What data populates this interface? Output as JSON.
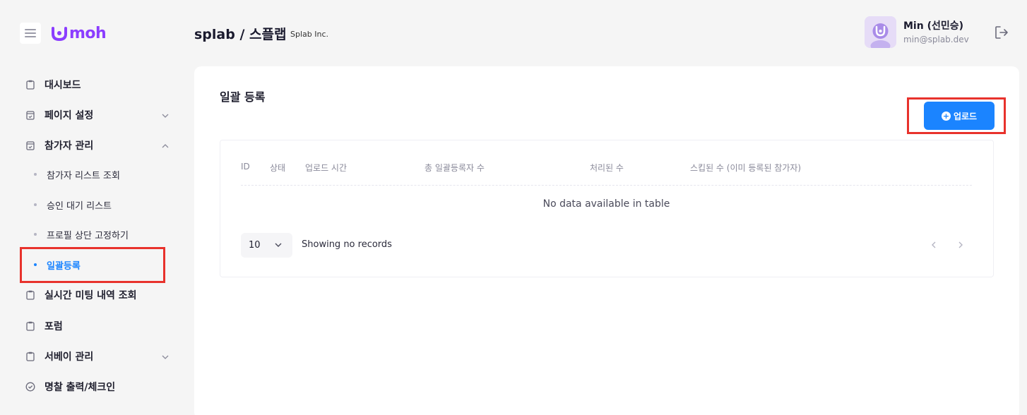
{
  "header": {
    "logo_text": "moh",
    "org_title": "splab / 스플랩",
    "org_subtitle": "Splab Inc.",
    "user_name": "Min (선민승)",
    "user_email": "min@splab.dev"
  },
  "sidebar": {
    "items": [
      {
        "label": "대시보드",
        "icon": "clipboard-icon"
      },
      {
        "label": "페이지 설정",
        "icon": "calendar-check-icon",
        "expandable": true,
        "expanded": false
      },
      {
        "label": "참가자 관리",
        "icon": "calendar-check-icon",
        "expandable": true,
        "expanded": true
      },
      {
        "label": "실시간 미팅 내역 조회",
        "icon": "clipboard-icon"
      },
      {
        "label": "포럼",
        "icon": "clipboard-icon"
      },
      {
        "label": "서베이 관리",
        "icon": "clipboard-icon",
        "expandable": true,
        "expanded": false
      },
      {
        "label": "명찰 출력/체크인",
        "icon": "check-circle-icon"
      }
    ],
    "subitems": [
      {
        "label": "참가자 리스트 조회",
        "active": false
      },
      {
        "label": "승인 대기 리스트",
        "active": false
      },
      {
        "label": "프로필 상단 고정하기",
        "active": false
      },
      {
        "label": "일괄등록",
        "active": true
      }
    ]
  },
  "main": {
    "title": "일괄 등록",
    "upload_label": "업로드",
    "table": {
      "columns": [
        "ID",
        "상태",
        "업로드 시간",
        "총 일괄등록자 수",
        "처리된 수",
        "스킵된 수 (이미 등록된 참가자)"
      ],
      "empty_message": "No data available in table",
      "page_size": "10",
      "records_info": "Showing no records"
    }
  },
  "colors": {
    "brand": "#8b3dff",
    "accent": "#1b84ff",
    "highlight": "#e8322c"
  }
}
